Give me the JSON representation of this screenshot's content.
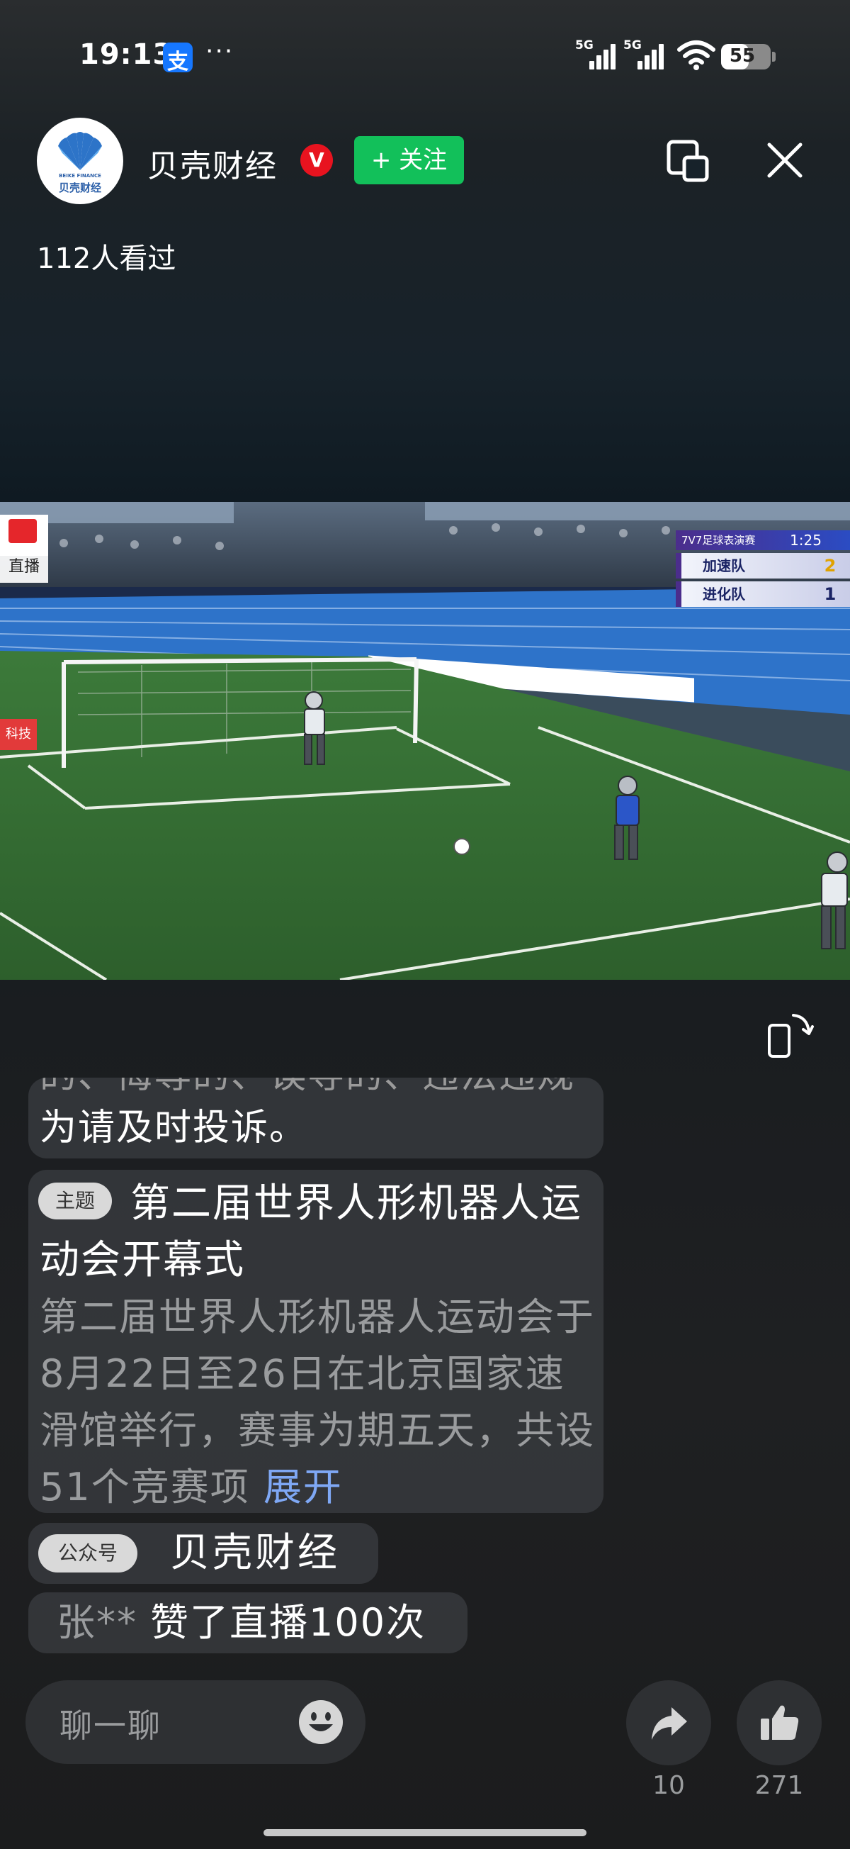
{
  "status_bar": {
    "time": "19:13",
    "app_icon": "alipay-icon",
    "app_icon_glyph": "支",
    "more": "···",
    "signal1_label": "5G",
    "signal2_label": "5G",
    "battery_level": "55",
    "battery_fraction": 0.55
  },
  "header": {
    "avatar_en": "BEIKE FINANCE",
    "avatar_cn": "贝壳财经",
    "account_name": "贝壳财经",
    "verified": "V",
    "follow_label": "+ 关注",
    "viewers": "112人看过",
    "accent_green": "#12c05a",
    "badge_red": "#e8131f"
  },
  "video": {
    "live_tag": "直播",
    "side_tag": "科技",
    "scoreboard": {
      "match": "7V7足球表演赛",
      "clock": "1:25",
      "teams": [
        {
          "name": "加速队",
          "score": "2"
        },
        {
          "name": "进化队",
          "score": "1"
        }
      ]
    }
  },
  "comments": {
    "truncated_top": "的、侮辱的、误导的、违法违规",
    "msg1": "为请及时投诉。",
    "topic_badge": "主题",
    "topic_title": "第二届世界人形机器人运动会开幕式",
    "topic_desc": "第二届世界人形机器人运动会于8月22日至26日在北京国家速滑馆举行，赛事为期五天，共设51个竞赛项",
    "expand": "展开",
    "pub_badge": "公众号",
    "pub_name": "贝壳财经",
    "like_user": "张**",
    "like_text": "赞了直播100次"
  },
  "bottom_bar": {
    "chat_placeholder": "聊一聊",
    "share_count": "10",
    "like_count": "271",
    "link_color": "#7fa8f5"
  }
}
